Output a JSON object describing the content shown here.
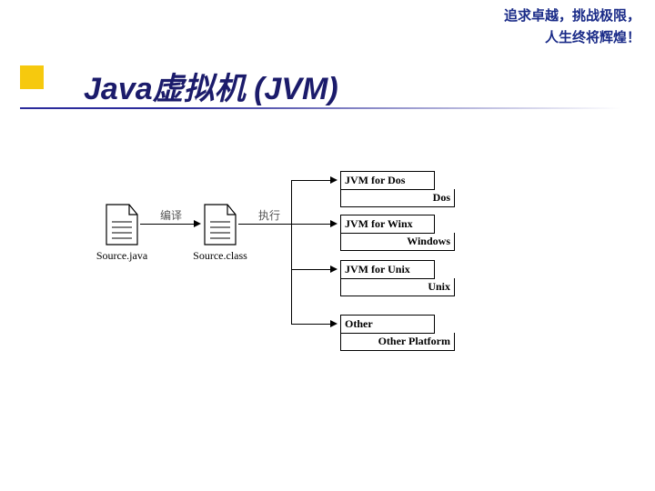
{
  "motto": {
    "line1": "追求卓越，挑战极限，",
    "line2": "人生终将辉煌！"
  },
  "title": "Java虚拟机 (JVM)",
  "diagram": {
    "source_file": "Source.java",
    "class_file": "Source.class",
    "compile_label": "编译",
    "run_label": "执行",
    "platforms": [
      {
        "jvm": "JVM for Dos",
        "os": "Dos"
      },
      {
        "jvm": "JVM for Winx",
        "os": "Windows"
      },
      {
        "jvm": "JVM for Unix",
        "os": "Unix"
      },
      {
        "jvm": "Other",
        "os": "Other Platform"
      }
    ]
  }
}
